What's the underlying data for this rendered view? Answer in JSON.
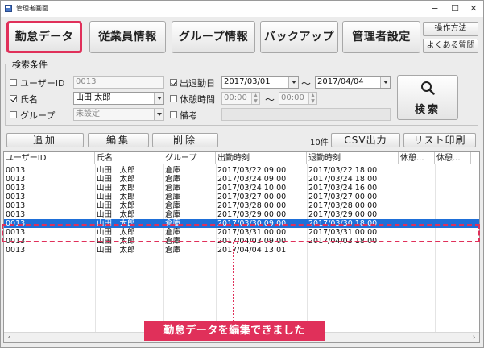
{
  "window": {
    "title": "管理者画面",
    "minimize": "−",
    "maximize": "☐",
    "close": "✕"
  },
  "nav": {
    "tabs": [
      {
        "label": "勤怠データ",
        "active": true
      },
      {
        "label": "従業員情報",
        "active": false
      },
      {
        "label": "グループ情報",
        "active": false
      },
      {
        "label": "バックアップ",
        "active": false
      },
      {
        "label": "管理者設定",
        "active": false
      }
    ],
    "help": "操作方法",
    "faq": "よくある質問"
  },
  "search": {
    "legend": "検索条件",
    "user_id": {
      "label": "ユーザーID",
      "value": "0013",
      "checked": false
    },
    "name": {
      "label": "氏名",
      "value": "山田 太郎",
      "checked": true
    },
    "group": {
      "label": "グループ",
      "value": "未設定",
      "checked": false
    },
    "date": {
      "label": "出退勤日",
      "from": "2017/03/01",
      "to": "2017/04/04",
      "checked": true,
      "range_sep": "～"
    },
    "rest": {
      "label": "休憩時間",
      "from": "00:00",
      "to": "00:00",
      "checked": false,
      "range_sep": "～"
    },
    "memo": {
      "label": "備考",
      "checked": false
    },
    "button": "検索"
  },
  "actions": {
    "add": "追加",
    "edit": "編集",
    "delete": "削除",
    "count": "10件",
    "csv": "CSV出力",
    "print": "リスト印刷"
  },
  "table": {
    "headers": [
      "ユーザーID",
      "氏名",
      "グループ",
      "出勤時刻",
      "退勤時刻",
      "休憩...",
      "休憩..."
    ],
    "rows": [
      [
        "0013",
        "山田　太郎",
        "倉庫",
        "2017/03/22 09:00",
        "2017/03/22 18:00",
        "",
        ""
      ],
      [
        "0013",
        "山田　太郎",
        "倉庫",
        "2017/03/24 09:00",
        "2017/03/24 18:00",
        "",
        ""
      ],
      [
        "0013",
        "山田　太郎",
        "倉庫",
        "2017/03/24 10:00",
        "2017/03/24 16:00",
        "",
        ""
      ],
      [
        "0013",
        "山田　太郎",
        "倉庫",
        "2017/03/27 00:00",
        "2017/03/27 00:00",
        "",
        ""
      ],
      [
        "0013",
        "山田　太郎",
        "倉庫",
        "2017/03/28 00:00",
        "2017/03/28 00:00",
        "",
        ""
      ],
      [
        "0013",
        "山田　太郎",
        "倉庫",
        "2017/03/29 00:00",
        "2017/03/29 00:00",
        "",
        ""
      ],
      [
        "0013",
        "山田　太郎",
        "倉庫",
        "2017/03/30 09:00",
        "2017/03/30 18:00",
        "",
        ""
      ],
      [
        "0013",
        "山田　太郎",
        "倉庫",
        "2017/03/31 00:00",
        "2017/03/31 00:00",
        "",
        ""
      ],
      [
        "0013",
        "山田　太郎",
        "倉庫",
        "2017/04/03 09:00",
        "2017/04/03 18:00",
        "",
        ""
      ],
      [
        "0013",
        "山田　太郎",
        "倉庫",
        "2017/04/04 13:01",
        "",
        "",
        ""
      ]
    ],
    "selected_row": 6
  },
  "annotation": {
    "caption": "勤怠データを編集できました",
    "color": "#e0305a"
  }
}
